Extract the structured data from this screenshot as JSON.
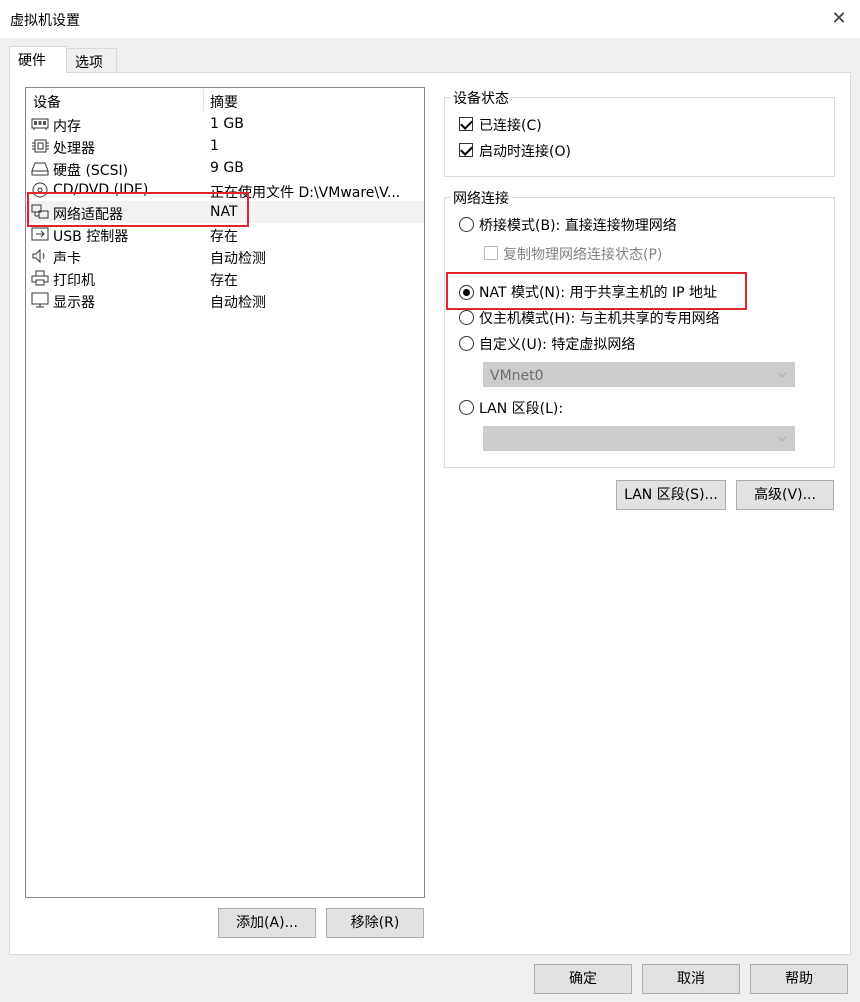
{
  "window": {
    "title": "虚拟机设置"
  },
  "tabs": [
    {
      "label": "硬件"
    },
    {
      "label": "选项"
    }
  ],
  "device_list": {
    "columns": [
      "设备",
      "摘要"
    ],
    "rows": [
      {
        "icon": "memory-icon",
        "name": "内存",
        "summary": "1 GB"
      },
      {
        "icon": "processor-icon",
        "name": "处理器",
        "summary": "1"
      },
      {
        "icon": "hard-disk-icon",
        "name": "硬盘 (SCSI)",
        "summary": "9 GB"
      },
      {
        "icon": "cd-dvd-icon",
        "name": "CD/DVD (IDE)",
        "summary": "正在使用文件 D:\\VMware\\V..."
      },
      {
        "icon": "network-adapter-icon",
        "name": "网络适配器",
        "summary": "NAT"
      },
      {
        "icon": "usb-icon",
        "name": "USB 控制器",
        "summary": "存在"
      },
      {
        "icon": "sound-card-icon",
        "name": "声卡",
        "summary": "自动检测"
      },
      {
        "icon": "printer-icon",
        "name": "打印机",
        "summary": "存在"
      },
      {
        "icon": "display-icon",
        "name": "显示器",
        "summary": "自动检测"
      }
    ],
    "selected_index": 4
  },
  "list_buttons": {
    "add": "添加(A)...",
    "remove": "移除(R)"
  },
  "device_status": {
    "label": "设备状态",
    "connected": {
      "label": "已连接(C)",
      "checked": true
    },
    "connect_at_power_on": {
      "label": "启动时连接(O)",
      "checked": true
    }
  },
  "network_connection": {
    "label": "网络连接",
    "bridged": {
      "label": "桥接模式(B): 直接连接物理网络",
      "selected": false
    },
    "replicate": {
      "label": "复制物理网络连接状态(P)",
      "checked": false
    },
    "nat": {
      "label": "NAT 模式(N): 用于共享主机的 IP 地址",
      "selected": true
    },
    "host_only": {
      "label": "仅主机模式(H): 与主机共享的专用网络",
      "selected": false
    },
    "custom": {
      "label": "自定义(U): 特定虚拟网络",
      "selected": false
    },
    "custom_select": {
      "value": "VMnet0"
    },
    "lan_segment": {
      "label": "LAN 区段(L):",
      "selected": false
    },
    "lan_select": {
      "value": ""
    }
  },
  "right_buttons": {
    "lan_segments": "LAN 区段(S)...",
    "advanced": "高级(V)..."
  },
  "dialog_buttons": {
    "ok": "确定",
    "cancel": "取消",
    "help": "帮助"
  },
  "colors": {
    "highlight": "#e0242b",
    "selected_row": "#f2f2f2",
    "disabled_combo": "#cccccc"
  }
}
